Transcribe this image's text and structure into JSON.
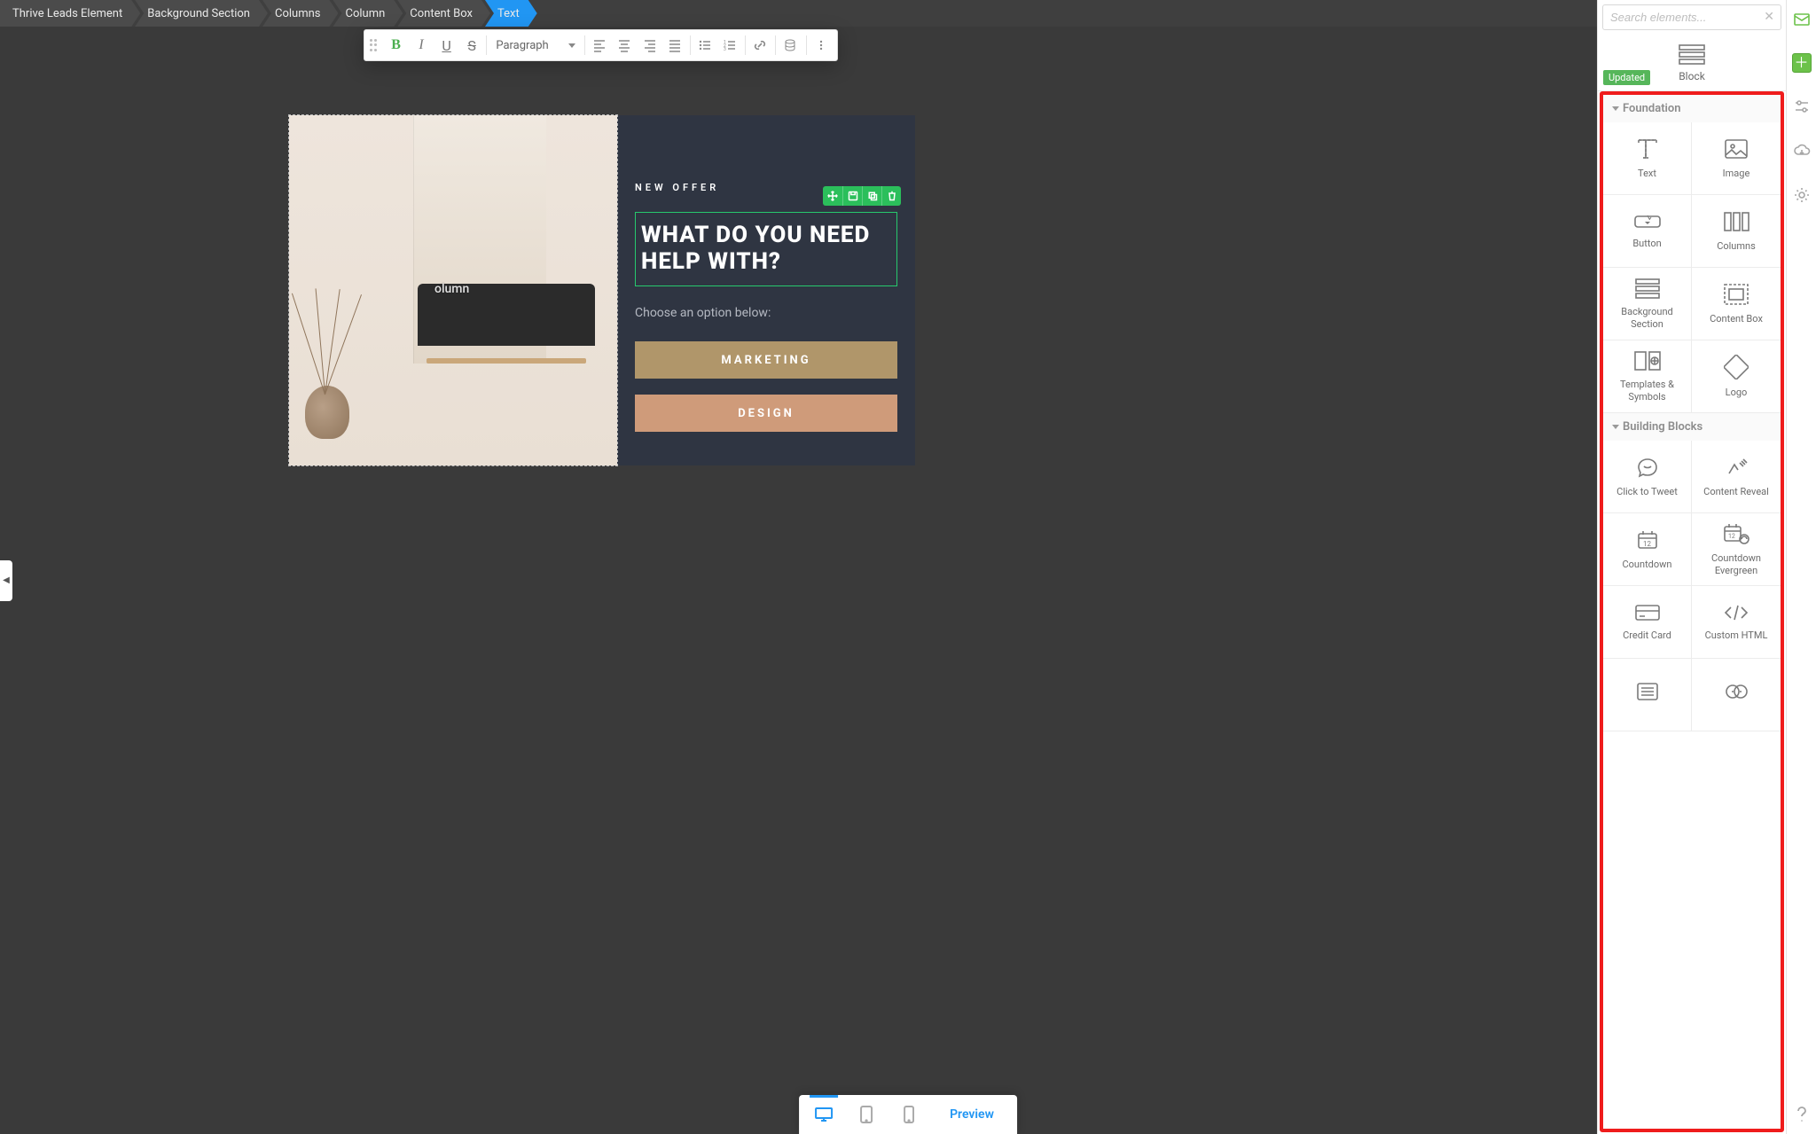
{
  "breadcrumbs": [
    "Thrive Leads Element",
    "Background Section",
    "Columns",
    "Column",
    "Content Box",
    "Text"
  ],
  "toolbar": {
    "format": "Paragraph"
  },
  "search": {
    "placeholder": "Search elements..."
  },
  "badge": "Updated",
  "block_label": "Block",
  "sections": {
    "foundation": {
      "title": "Foundation",
      "items": [
        "Text",
        "Image",
        "Button",
        "Columns",
        "Background Section",
        "Content Box",
        "Templates & Symbols",
        "Logo"
      ]
    },
    "building": {
      "title": "Building Blocks",
      "items": [
        "Click to Tweet",
        "Content Reveal",
        "Countdown",
        "Countdown Evergreen",
        "Credit Card",
        "Custom HTML"
      ]
    }
  },
  "widget": {
    "label": "NEW OFFER",
    "heading": "WHAT DO YOU NEED HELP WITH?",
    "subtext": "Choose an option below:",
    "btn1": "MARKETING",
    "btn2": "DESIGN",
    "placeholder": "olumn"
  },
  "bottom": {
    "preview": "Preview"
  }
}
